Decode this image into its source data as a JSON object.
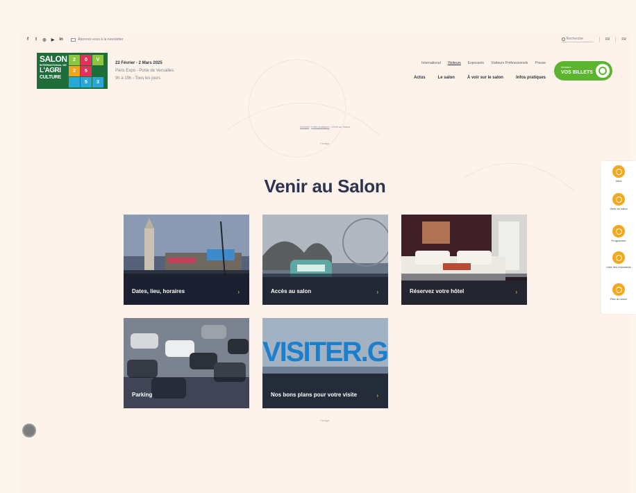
{
  "utility_bar": {
    "social": [
      {
        "icon": "facebook-icon",
        "glyph": "f"
      },
      {
        "icon": "twitter-icon",
        "glyph": "t"
      },
      {
        "icon": "instagram-icon",
        "glyph": "◎"
      },
      {
        "icon": "youtube-icon",
        "glyph": "▶"
      },
      {
        "icon": "linkedin-icon",
        "glyph": "in"
      }
    ],
    "newsletter_label": "Abonnez-vous à la newsletter",
    "search_placeholder": "Recherche",
    "language": "FR",
    "region": "FR"
  },
  "logo": {
    "line1": "SALON",
    "line2": "INTERNATIONAL DE",
    "line3": "L'AGRI",
    "line4": "CULTURE",
    "cells": [
      {
        "glyph": "2",
        "color": "#8cc63e"
      },
      {
        "glyph": "0",
        "color": "#e2325b"
      },
      {
        "glyph": "V",
        "color": "#8cc63e"
      },
      {
        "glyph": "2",
        "color": "#f1a51d"
      },
      {
        "glyph": "5",
        "color": "#e2325b"
      },
      {
        "glyph": "",
        "color": "#1e6d3a"
      },
      {
        "glyph": "",
        "color": "#29a8d8"
      },
      {
        "glyph": "5",
        "color": "#29a8d8"
      },
      {
        "glyph": "3",
        "color": "#29a8d8"
      }
    ]
  },
  "event": {
    "date": "22 Février - 2 Mars 2025",
    "venue": "Paris Expo - Porte de Versailles",
    "hours": "9h à 19h - Tous les jours"
  },
  "nav_top": [
    "International",
    "Visiteurs",
    "Exposants",
    "Visiteurs Professionnels",
    "Presse"
  ],
  "nav_top_active": "Visiteurs",
  "nav_main": [
    "Actus",
    "Le salon",
    "À voir sur le salon",
    "Infos pratiques"
  ],
  "tickets": {
    "small": "Achetez",
    "big": "VOS BILLETS"
  },
  "breadcrumb": {
    "home": "Accueil",
    "section": "Infos pratiques",
    "current": "Venir au Salon"
  },
  "share_label": "Partager",
  "page_title": "Venir au Salon",
  "cards": [
    {
      "name": "card-dates",
      "label": "Dates, lieu, horaires"
    },
    {
      "name": "card-acces",
      "label": "Accès au salon"
    },
    {
      "name": "card-hotel",
      "label": "Réservez votre hôtel"
    },
    {
      "name": "card-parking",
      "label": "Parking"
    },
    {
      "name": "card-bons-plans",
      "label": "Nos bons plans pour votre visite",
      "image_text": "VISITER.GO!"
    }
  ],
  "side_menu": [
    {
      "name": "side-infos",
      "label": "Infos"
    },
    {
      "name": "side-venir",
      "label": "Venir au salon"
    },
    {
      "name": "side-programme",
      "label": "Programme"
    },
    {
      "name": "side-exposants",
      "label": "Liste des exposants"
    },
    {
      "name": "side-plan",
      "label": "Plan du salon"
    }
  ],
  "colors": {
    "accent_green": "#5cb431",
    "accent_orange": "#f2a91e",
    "title_navy": "#2c3550",
    "logo_green": "#1e6d3a"
  }
}
